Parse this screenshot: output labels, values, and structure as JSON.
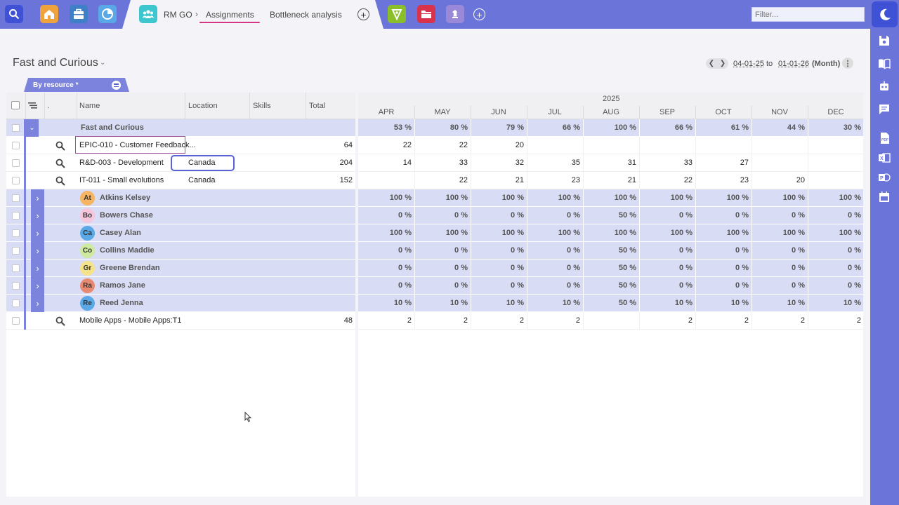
{
  "topbar": {
    "app_name": "RM GO",
    "tab_assignments": "Assignments",
    "tab_bottleneck": "Bottleneck analysis",
    "filter_placeholder": "Filter..."
  },
  "header": {
    "view_title": "Fast and Curious",
    "date_from": "04-01-25",
    "date_to_word": "to",
    "date_to": "01-01-26",
    "period": "(Month)",
    "view_tab": "By resource *"
  },
  "columns": {
    "dot": ".",
    "name": "Name",
    "location": "Location",
    "skills": "Skills",
    "total": "Total",
    "year": "2025",
    "months": [
      "APR",
      "MAY",
      "JUN",
      "JUL",
      "AUG",
      "SEP",
      "OCT",
      "NOV",
      "DEC"
    ]
  },
  "rows": [
    {
      "type": "group",
      "name": "Fast and Curious",
      "values": [
        "53 %",
        "80 %",
        "79 %",
        "66 %",
        "100 %",
        "66 %",
        "61 %",
        "44 %",
        "30 %"
      ]
    },
    {
      "type": "task",
      "name": "EPIC-010 - Customer Feedback...",
      "location": "",
      "total": "64",
      "values": [
        "22",
        "22",
        "20",
        "",
        "",
        "",
        "",
        "",
        ""
      ]
    },
    {
      "type": "task",
      "name": "R&D-003 - Development",
      "location": "Canada",
      "total": "204",
      "values": [
        "14",
        "33",
        "32",
        "35",
        "31",
        "33",
        "27",
        "",
        ""
      ]
    },
    {
      "type": "task",
      "name": "IT-011 - Small evolutions",
      "location": "Canada",
      "total": "152",
      "values": [
        "",
        "22",
        "21",
        "23",
        "21",
        "22",
        "23",
        "20",
        ""
      ]
    },
    {
      "type": "resource",
      "initials": "At",
      "avatar_color": "#f5b562",
      "name": "Atkins Kelsey",
      "values": [
        "100 %",
        "100 %",
        "100 %",
        "100 %",
        "100 %",
        "100 %",
        "100 %",
        "100 %",
        "100 %"
      ]
    },
    {
      "type": "resource",
      "initials": "Bo",
      "avatar_color": "#f6c6dc",
      "name": "Bowers Chase",
      "values": [
        "0 %",
        "0 %",
        "0 %",
        "0 %",
        "50 %",
        "0 %",
        "0 %",
        "0 %",
        "0 %"
      ]
    },
    {
      "type": "resource",
      "initials": "Ca",
      "avatar_color": "#5aa8e6",
      "name": "Casey Alan",
      "values": [
        "100 %",
        "100 %",
        "100 %",
        "100 %",
        "100 %",
        "100 %",
        "100 %",
        "100 %",
        "100 %"
      ]
    },
    {
      "type": "resource",
      "initials": "Co",
      "avatar_color": "#cdeaa0",
      "name": "Collins Maddie",
      "values": [
        "0 %",
        "0 %",
        "0 %",
        "0 %",
        "50 %",
        "0 %",
        "0 %",
        "0 %",
        "0 %"
      ]
    },
    {
      "type": "resource",
      "initials": "Gr",
      "avatar_color": "#f5e38a",
      "name": "Greene Brendan",
      "values": [
        "0 %",
        "0 %",
        "0 %",
        "0 %",
        "50 %",
        "0 %",
        "0 %",
        "0 %",
        "0 %"
      ]
    },
    {
      "type": "resource",
      "initials": "Ra",
      "avatar_color": "#e88a72",
      "name": "Ramos Jane",
      "values": [
        "0 %",
        "0 %",
        "0 %",
        "0 %",
        "50 %",
        "0 %",
        "0 %",
        "0 %",
        "0 %"
      ]
    },
    {
      "type": "resource",
      "initials": "Re",
      "avatar_color": "#5aa8e6",
      "name": "Reed Jenna",
      "values": [
        "10 %",
        "10 %",
        "10 %",
        "10 %",
        "50 %",
        "10 %",
        "10 %",
        "10 %",
        "10 %"
      ]
    },
    {
      "type": "task",
      "name": "Mobile Apps - Mobile Apps:T1",
      "location": "",
      "total": "48",
      "values": [
        "2",
        "2",
        "2",
        "2",
        "",
        "2",
        "2",
        "2",
        "2"
      ]
    }
  ],
  "icons": {
    "search": "search-icon",
    "home": "home-icon",
    "briefcase": "briefcase-icon",
    "pie": "pie-chart-icon",
    "team": "team-icon",
    "shield": "shield-icon",
    "folder": "folder-icon",
    "chess": "chess-icon",
    "moon": "moon-icon",
    "save": "save-icon",
    "book": "book-icon",
    "robot": "robot-icon",
    "chat": "chat-icon",
    "pdf": "pdf-icon",
    "excel": "excel-icon",
    "ppt": "powerpoint-icon",
    "calendar": "calendar-icon"
  },
  "colors": {
    "accent": "#6b74d9",
    "group_row": "#d9dcf5",
    "selection_pink": "#d63384"
  }
}
